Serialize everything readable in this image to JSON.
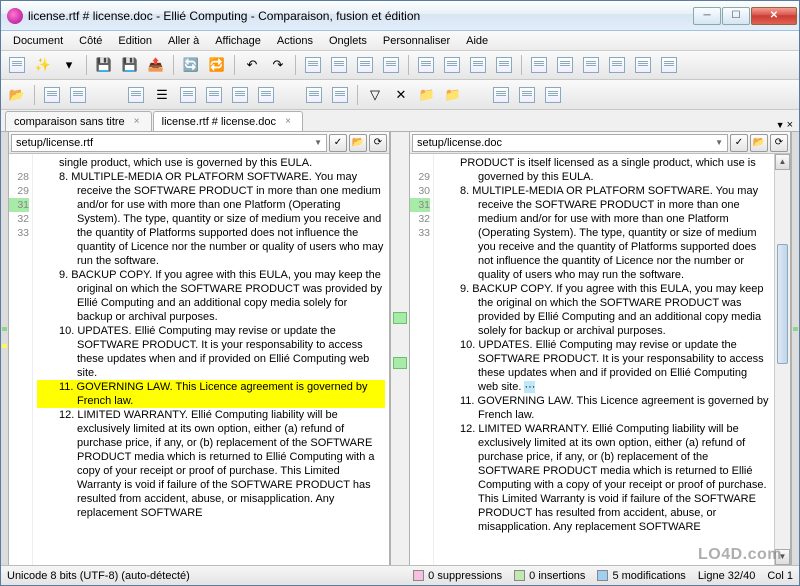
{
  "window": {
    "title": "license.rtf # license.doc - Ellié Computing - Comparaison, fusion et édition"
  },
  "menu": [
    "Document",
    "Côté",
    "Edition",
    "Aller à",
    "Affichage",
    "Actions",
    "Onglets",
    "Personnaliser",
    "Aide"
  ],
  "tabs": [
    {
      "label": "comparaison sans titre",
      "active": false
    },
    {
      "label": "license.rtf # license.doc",
      "active": true
    }
  ],
  "panes": {
    "left": {
      "path": "setup/license.rtf",
      "lines": [
        {
          "n": "",
          "text": "single product, which use is governed by this EULA.",
          "indent": true
        },
        {
          "n": "28",
          "text": "8. MULTIPLE-MEDIA OR PLATFORM SOFTWARE. You may receive the SOFTWARE PRODUCT in more than one medium and/or for use with more than one Platform (Operating System). The type, quantity or size of medium you receive and the quantity of Platforms supported does not influence the quantity of Licence nor the number or quality of users who may run the software.",
          "indent": true
        },
        {
          "n": "29",
          "text": "9. BACKUP COPY. If you agree with this EULA, you may keep the original on which the SOFTWARE PRODUCT was provided by Ellié Computing and an additional copy media solely for backup or archival purposes.",
          "indent": true
        },
        {
          "n": "31",
          "text": "10. UPDATES. Ellié Computing may revise or update the SOFTWARE PRODUCT. It is your responsability to access these updates when and if provided on Ellié Computing web site.",
          "indent": true,
          "mark": true
        },
        {
          "n": "32",
          "text": "11. GOVERNING LAW. This Licence agreement is governed by French law.",
          "indent": true,
          "hl": true
        },
        {
          "n": "33",
          "text": "12. LIMITED WARRANTY. Ellié Computing liability will be exclusively limited at its own option, either (a) refund of purchase price, if any, or (b) replacement of the SOFTWARE PRODUCT media which is returned to Ellié Computing with a copy of your receipt or proof of purchase. This Limited Warranty is void if failure of the SOFTWARE PRODUCT has resulted from accident, abuse, or misapplication. Any replacement SOFTWARE",
          "indent": true
        }
      ]
    },
    "right": {
      "path": "setup/license.doc",
      "lines": [
        {
          "n": "",
          "text": "PRODUCT is itself licensed as a single product, which use is governed by this EULA.",
          "indent": true
        },
        {
          "n": "29",
          "text": "8. MULTIPLE-MEDIA OR PLATFORM SOFTWARE. You may receive the SOFTWARE PRODUCT in more than one medium and/or for use with more than one Platform (Operating System). The type, quantity or size of medium you receive and the quantity of Platforms supported does not influence the quantity of Licence nor the number or quality of users who may run the software.",
          "indent": true
        },
        {
          "n": "30",
          "text": "9. BACKUP COPY. If you agree with this EULA, you may keep the original on which the SOFTWARE PRODUCT was provided by Ellié Computing and an additional copy media solely for backup or archival purposes.",
          "indent": true
        },
        {
          "n": "31",
          "text": "10. UPDATES. Ellié Computing may revise or update the SOFTWARE PRODUCT. It is your responsability to access these updates when and if provided on Ellié Computing web site. ",
          "indent": true,
          "mark": true,
          "inline_hl": "···"
        },
        {
          "n": "32",
          "text": "11. GOVERNING LAW. This Licence agreement is governed by French law.",
          "indent": true
        },
        {
          "n": "33",
          "text": "12. LIMITED WARRANTY. Ellié Computing liability will be exclusively limited at its own option, either (a) refund of purchase price, if any, or (b) replacement of the SOFTWARE PRODUCT media which is returned to Ellié Computing with a copy of your receipt or proof of purchase. This Limited Warranty is void if failure of the SOFTWARE PRODUCT has resulted from accident, abuse, or misapplication. Any replacement SOFTWARE",
          "indent": true
        }
      ]
    }
  },
  "status": {
    "encoding": "Unicode 8 bits (UTF-8) (auto-détecté)",
    "suppressions": "0 suppressions",
    "insertions": "0 insertions",
    "modifications": "5 modifications",
    "line": "Ligne 32/40",
    "col": "Col 1"
  },
  "colors": {
    "supp": "#f7c0e0",
    "ins": "#c0e8b0",
    "mod": "#a0d0f0"
  },
  "watermark": "LO4D.com"
}
